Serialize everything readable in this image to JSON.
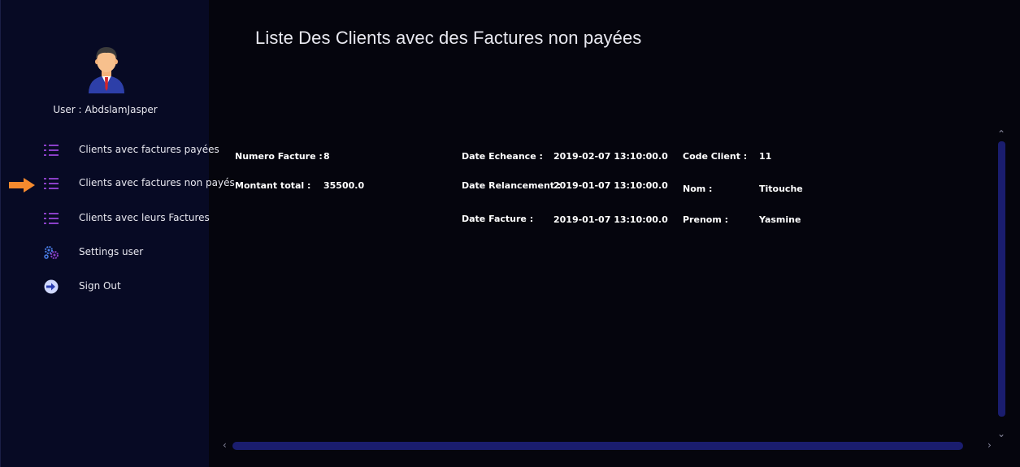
{
  "sidebar": {
    "user_prefix": "User :",
    "user_name": "AbdslamJasper",
    "items": [
      {
        "label": "Clients avec factures payées",
        "icon": "list-icon"
      },
      {
        "label": "Clients avec factures non payés",
        "icon": "list-icon",
        "active": true
      },
      {
        "label": "Clients avec leurs Factures",
        "icon": "list-icon"
      },
      {
        "label": "Settings user",
        "icon": "gear-icon"
      },
      {
        "label": "Sign Out",
        "icon": "sign-out-icon"
      }
    ]
  },
  "main": {
    "title": "Liste Des Clients avec des Factures non payées",
    "invoice": {
      "numero_label": "Numero Facture :",
      "numero_value": "8",
      "montant_label": "Montant total :",
      "montant_value": "35500.0",
      "echeance_label": "Date Echeance :",
      "echeance_value": "2019-02-07 13:10:00.0",
      "relancement_label": "Date Relancement :",
      "relancement_value": "2019-01-07 13:10:00.0",
      "facture_label": "Date Facture :",
      "facture_value": "2019-01-07 13:10:00.0",
      "code_label": "Code Client :",
      "code_value": "11",
      "nom_label": "Nom :",
      "nom_value": "Titouche",
      "prenom_label": "Prenom :",
      "prenom_value": "Yasmine"
    }
  },
  "colors": {
    "background": "#05050d",
    "sidebar": "#070a24",
    "accent_arrow": "#f58a2e",
    "scrollbar": "#1a1d6e",
    "icon_purple": "#8a3fc7"
  }
}
